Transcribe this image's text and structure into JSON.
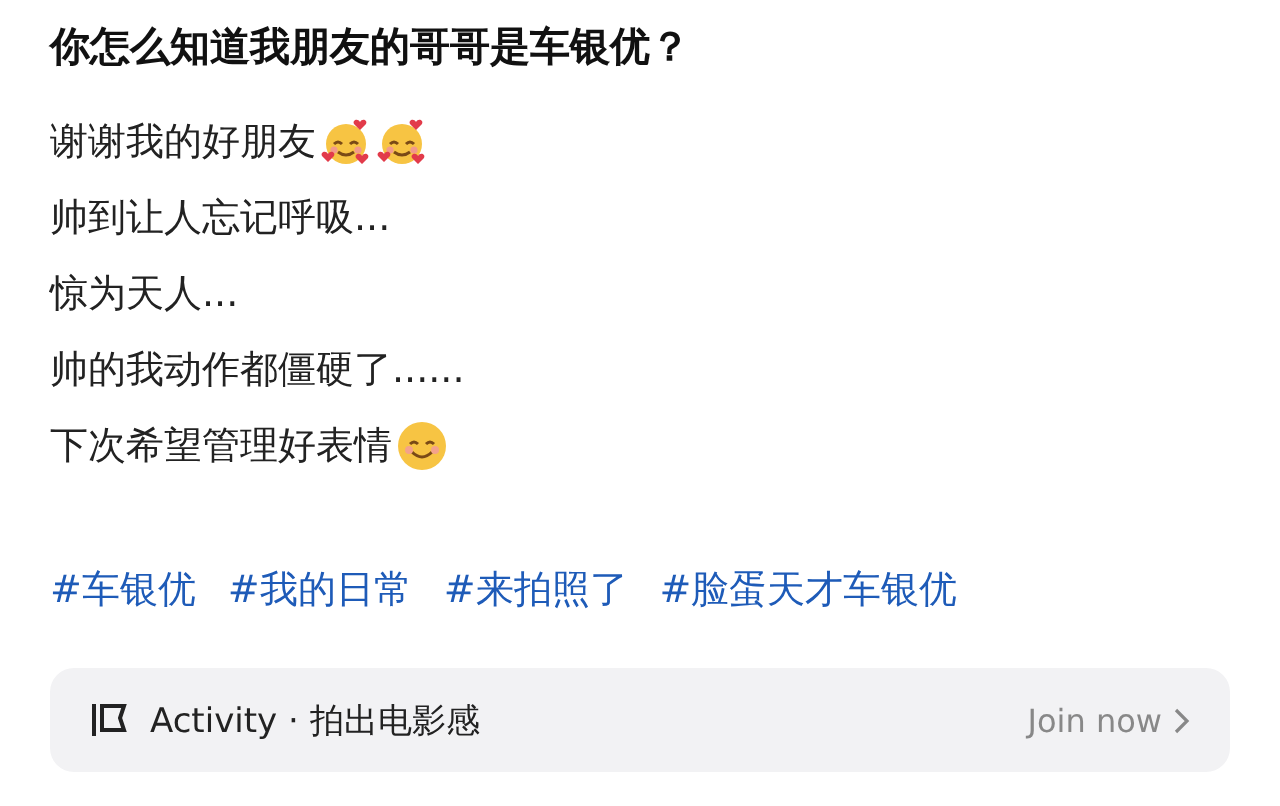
{
  "title": "你怎么知道我朋友的哥哥是车银优？",
  "lines": [
    {
      "text": "谢谢我的好朋友",
      "emoji": [
        {
          "kind": "hearts"
        },
        {
          "kind": "hearts"
        }
      ]
    },
    {
      "text": "帅到让人忘记呼吸..."
    },
    {
      "text": "惊为天人..."
    },
    {
      "text": "帅的我动作都僵硬了......"
    },
    {
      "text": "下次希望管理好表情",
      "emoji": [
        {
          "kind": "smile"
        }
      ]
    }
  ],
  "hashtags": [
    "#车银优",
    "#我的日常",
    "#来拍照了",
    "#脸蛋天才车银优"
  ],
  "activity": {
    "label": "Activity · 拍出电影感",
    "action": "Join now"
  }
}
